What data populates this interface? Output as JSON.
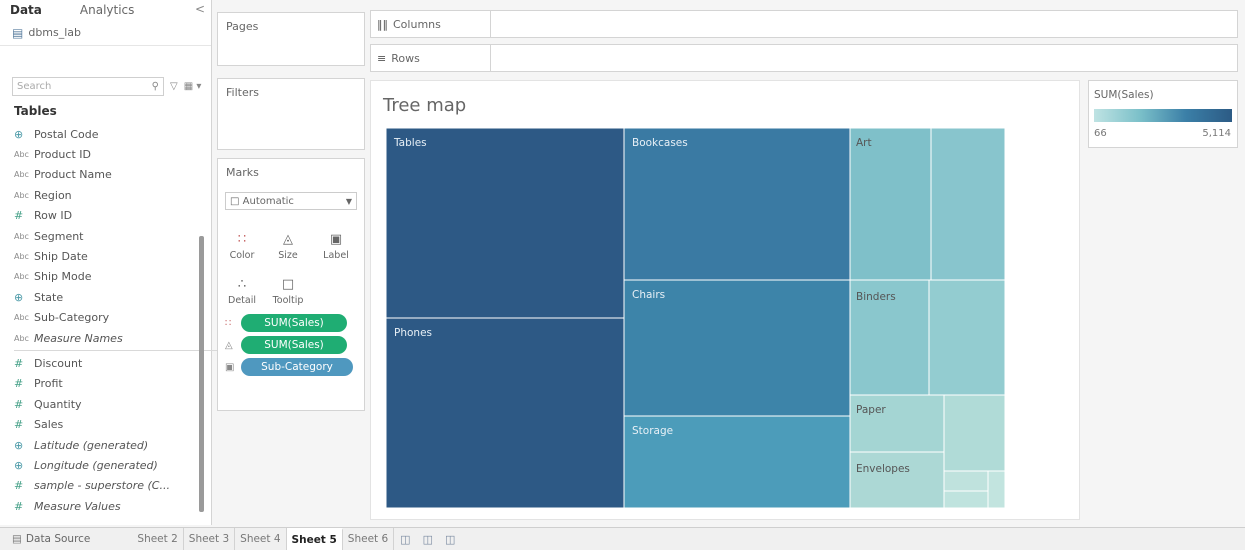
{
  "data_pane": {
    "tabs": [
      "Data",
      "Analytics"
    ],
    "collapse_icon": "chevron-left-icon",
    "datasource": "dbms_lab",
    "search_placeholder": "Search",
    "tables_heading": "Tables",
    "fields": [
      {
        "name": "Postal Code",
        "icon": "globe",
        "italic": false
      },
      {
        "name": "Product ID",
        "icon": "abc",
        "italic": false
      },
      {
        "name": "Product Name",
        "icon": "abc",
        "italic": false
      },
      {
        "name": "Region",
        "icon": "abc",
        "italic": false
      },
      {
        "name": "Row ID",
        "icon": "num",
        "italic": false
      },
      {
        "name": "Segment",
        "icon": "abc",
        "italic": false
      },
      {
        "name": "Ship Date",
        "icon": "abc",
        "italic": false
      },
      {
        "name": "Ship Mode",
        "icon": "abc",
        "italic": false
      },
      {
        "name": "State",
        "icon": "globe",
        "italic": false
      },
      {
        "name": "Sub-Category",
        "icon": "abc",
        "italic": false
      },
      {
        "name": "Measure Names",
        "icon": "abc",
        "italic": true,
        "divider_after": true
      },
      {
        "name": "Discount",
        "icon": "num",
        "italic": false
      },
      {
        "name": "Profit",
        "icon": "num",
        "italic": false
      },
      {
        "name": "Quantity",
        "icon": "num",
        "italic": false
      },
      {
        "name": "Sales",
        "icon": "num",
        "italic": false
      },
      {
        "name": "Latitude (generated)",
        "icon": "globe",
        "italic": true
      },
      {
        "name": "Longitude (generated)",
        "icon": "globe",
        "italic": true
      },
      {
        "name": "sample - superstore (C...",
        "icon": "num",
        "italic": true
      },
      {
        "name": "Measure Values",
        "icon": "num",
        "italic": true
      }
    ]
  },
  "cards": {
    "pages": "Pages",
    "filters": "Filters",
    "marks": "Marks",
    "mark_type": "Automatic",
    "mark_buttons": [
      {
        "label": "Color",
        "icon": "color-icon"
      },
      {
        "label": "Size",
        "icon": "size-icon"
      },
      {
        "label": "Label",
        "icon": "label-icon"
      },
      {
        "label": "Detail",
        "icon": "detail-icon"
      },
      {
        "label": "Tooltip",
        "icon": "tooltip-icon"
      }
    ],
    "pills": [
      {
        "text": "SUM(Sales)",
        "icon": "color-icon",
        "style": "green"
      },
      {
        "text": "SUM(Sales)",
        "icon": "size-icon",
        "style": "green"
      },
      {
        "text": "Sub-Category",
        "icon": "label-icon",
        "style": "blue"
      }
    ]
  },
  "shelves": {
    "columns": "Columns",
    "rows": "Rows"
  },
  "view": {
    "title": "Tree map"
  },
  "legend": {
    "title": "SUM(Sales)",
    "min": "66",
    "max": "5,114",
    "colors": [
      "#bfe3e3",
      "#2c5b85"
    ]
  },
  "tabbar": {
    "data_source": "Data Source",
    "sheets": [
      "Sheet 2",
      "Sheet 3",
      "Sheet 4",
      "Sheet 5",
      "Sheet 6"
    ],
    "active_sheet": "Sheet 5"
  },
  "chart_data": {
    "type": "treemap",
    "title": "Tree map",
    "size_measure": "SUM(Sales)",
    "color_measure": "SUM(Sales)",
    "label_field": "Sub-Category",
    "color_range": [
      "66",
      "5,114"
    ],
    "tiles": [
      {
        "label": "Tables",
        "color": "#2d5985"
      },
      {
        "label": "Phones",
        "color": "#2d5985"
      },
      {
        "label": "Bookcases",
        "color": "#3a7aa3"
      },
      {
        "label": "Chairs",
        "color": "#3d84a9"
      },
      {
        "label": "Storage",
        "color": "#4c9cba"
      },
      {
        "label": "Art",
        "color": "#7fc0c9"
      },
      {
        "label": "",
        "color": "#88c5cd"
      },
      {
        "label": "Binders",
        "color": "#8ac7cd"
      },
      {
        "label": "",
        "color": "#93ccd0"
      },
      {
        "label": "Paper",
        "color": "#a4d5d3"
      },
      {
        "label": "",
        "color": "#b0dbd7"
      },
      {
        "label": "Envelopes",
        "color": "#acd8d5"
      },
      {
        "label": "",
        "color": "#bfe2dd"
      },
      {
        "label": "",
        "color": "#bfe3de"
      },
      {
        "label": "",
        "color": "#c2e4df"
      }
    ]
  }
}
